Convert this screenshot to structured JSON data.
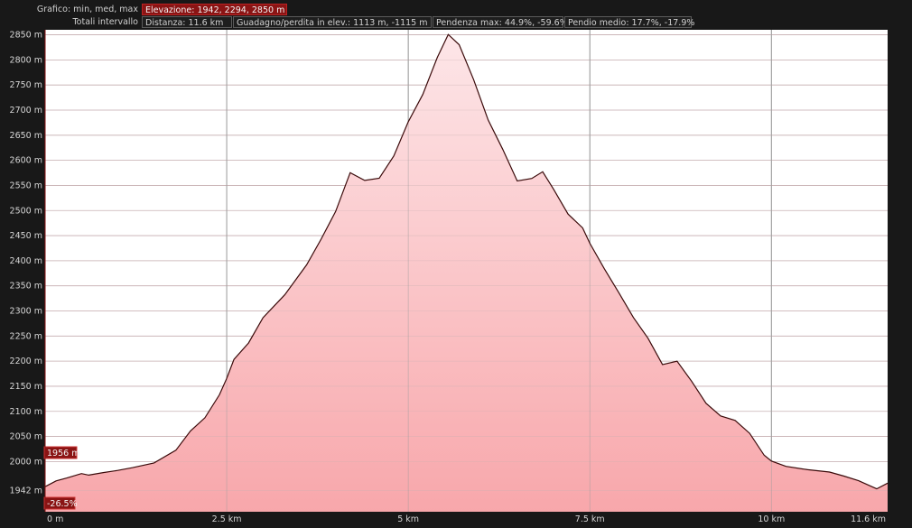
{
  "header": {
    "row1_label": "Grafico: min, med, max",
    "elevation_stat": "Elevazione: 1942, 2294, 2850 m",
    "row2_label": "Totali intervallo",
    "distance_stat": "Distanza: 11.6 km",
    "gain_loss_stat": "Guadagno/perdita in elev.: 1113 m, -1115 m",
    "max_slope_stat": "Pendenza max: 44.9%, -59.6%",
    "avg_slope_stat": "Pendio medio: 17.7%, -17.9%"
  },
  "markers": {
    "current_elevation": "1956 m",
    "current_slope": "-26.5%"
  },
  "colors": {
    "background": "#181818",
    "plot_fill_top": "#fde6e8",
    "plot_fill_bottom": "#f8a7ab",
    "profile_line": "#3a0a0a",
    "gridline": "#c8b0b2",
    "marker_box": "#8a1414"
  },
  "chart_data": {
    "type": "area",
    "title": "",
    "xlabel": "",
    "ylabel": "",
    "xlim": [
      0,
      11.6
    ],
    "ylim": [
      1900,
      2860
    ],
    "x_ticks": [
      0,
      2.5,
      5,
      7.5,
      10,
      11.6
    ],
    "x_tick_labels": [
      "0 m",
      "2.5 km",
      "5 km",
      "7.5 km",
      "10 km",
      "11.6 km"
    ],
    "y_ticks": [
      1942,
      2000,
      2050,
      2100,
      2150,
      2200,
      2250,
      2300,
      2350,
      2400,
      2450,
      2500,
      2550,
      2600,
      2650,
      2700,
      2750,
      2800,
      2850
    ],
    "y_tick_labels": [
      "1942 m",
      "2000 m",
      "2050 m",
      "2100 m",
      "2150 m",
      "2200 m",
      "2250 m",
      "2300 m",
      "2350 m",
      "2400 m",
      "2450 m",
      "2500 m",
      "2550 m",
      "2600 m",
      "2650 m",
      "2700 m",
      "2750 m",
      "2800 m",
      "2850 m"
    ],
    "grid": true,
    "series": [
      {
        "x": [
          0,
          0.15,
          0.3,
          0.5,
          0.6,
          0.8,
          1.0,
          1.2,
          1.5,
          1.8,
          2.0,
          2.2,
          2.4,
          2.5,
          2.6,
          2.8,
          3.0,
          3.3,
          3.6,
          3.8,
          4.0,
          4.2,
          4.4,
          4.6,
          4.8,
          5.0,
          5.2,
          5.4,
          5.55,
          5.7,
          5.9,
          6.1,
          6.3,
          6.5,
          6.7,
          6.85,
          7.0,
          7.2,
          7.4,
          7.5,
          7.7,
          7.9,
          8.1,
          8.3,
          8.5,
          8.7,
          8.9,
          9.1,
          9.3,
          9.5,
          9.7,
          9.9,
          10.0,
          10.2,
          10.5,
          10.8,
          11.0,
          11.2,
          11.45,
          11.6
        ],
        "y": [
          1950,
          1962,
          1968,
          1977,
          1974,
          1979,
          1983,
          1988,
          1997,
          2022,
          2060,
          2086,
          2132,
          2165,
          2203,
          2236,
          2287,
          2333,
          2393,
          2444,
          2499,
          2576,
          2560,
          2564,
          2608,
          2676,
          2730,
          2804,
          2850,
          2830,
          2761,
          2681,
          2623,
          2560,
          2565,
          2578,
          2543,
          2493,
          2465,
          2434,
          2383,
          2335,
          2286,
          2245,
          2193,
          2200,
          2161,
          2117,
          2092,
          2083,
          2057,
          2013,
          2001,
          1990,
          1983,
          1978,
          1970,
          1961,
          1945,
          1957
        ]
      }
    ]
  }
}
